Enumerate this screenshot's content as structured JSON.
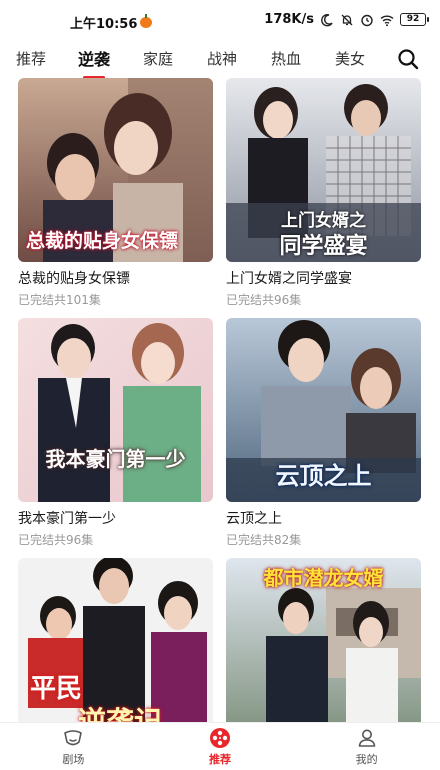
{
  "status_bar": {
    "time": "上午10:56",
    "network_speed": "178K/s",
    "battery": "92"
  },
  "top_tabs": [
    {
      "label": "推荐",
      "active": false
    },
    {
      "label": "逆袭",
      "active": true
    },
    {
      "label": "家庭",
      "active": false
    },
    {
      "label": "战神",
      "active": false
    },
    {
      "label": "热血",
      "active": false
    },
    {
      "label": "美女",
      "active": false
    }
  ],
  "search_icon": "search-icon",
  "cards": [
    {
      "title": "总裁的贴身女保镖",
      "status": "已完结共101集",
      "poster_text": "总裁的贴身女保镖"
    },
    {
      "title": "上门女婿之同学盛宴",
      "status": "已完结共96集",
      "poster_text_top": "上门女婿之",
      "poster_text_bottom": "同学盛宴"
    },
    {
      "title": "我本豪门第一少",
      "status": "已完结共96集",
      "poster_text": "我本豪门第一少"
    },
    {
      "title": "云顶之上",
      "status": "已完结共82集",
      "poster_text": "云顶之上"
    },
    {
      "title": "平民逆袭记",
      "status": "",
      "poster_text_top": "平民",
      "poster_text_bottom": "逆袭记"
    },
    {
      "title": "都市潜龙女婿",
      "status": "",
      "poster_text": "都市潜龙女婿"
    }
  ],
  "bottom_nav": [
    {
      "label": "剧场",
      "icon": "theater-icon",
      "active": false
    },
    {
      "label": "推荐",
      "icon": "film-reel-icon",
      "active": true
    },
    {
      "label": "我的",
      "icon": "user-icon",
      "active": false
    }
  ],
  "colors": {
    "accent": "#e8262b"
  }
}
